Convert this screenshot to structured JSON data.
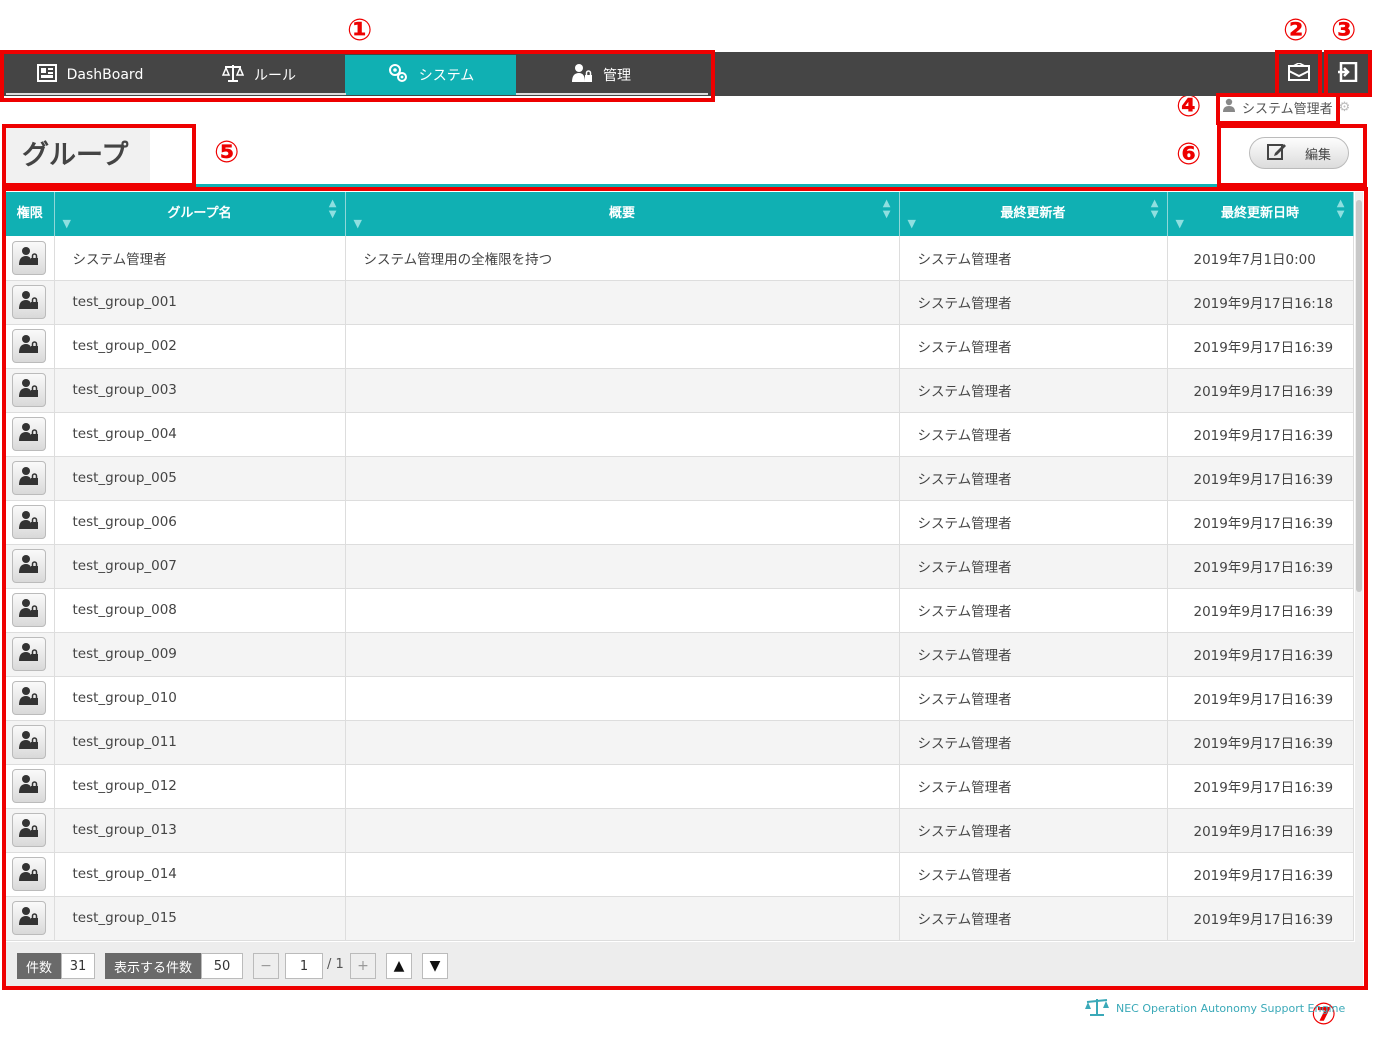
{
  "nav": {
    "items": [
      {
        "label": "DashBoard",
        "icon": "dashboard-icon"
      },
      {
        "label": "ルール",
        "icon": "scale-icon"
      },
      {
        "label": "システム",
        "icon": "gears-icon",
        "active": true
      },
      {
        "label": "管理",
        "icon": "user-lock-icon"
      }
    ]
  },
  "header": {
    "mail_icon": "mail-icon",
    "logout_icon": "logout-icon",
    "user_name": "システム管理者",
    "user_icon": "user-icon",
    "settings_icon": "gear-icon"
  },
  "page": {
    "title": "グループ",
    "edit_label": "編集"
  },
  "table": {
    "columns": [
      "権限",
      "グループ名",
      "概要",
      "最終更新者",
      "最終更新日時"
    ],
    "rows": [
      {
        "name": "システム管理者",
        "summary": "システム管理用の全権限を持つ",
        "updater": "システム管理者",
        "updated": "2019年7月1日0:00"
      },
      {
        "name": "test_group_001",
        "summary": "",
        "updater": "システム管理者",
        "updated": "2019年9月17日16:18"
      },
      {
        "name": "test_group_002",
        "summary": "",
        "updater": "システム管理者",
        "updated": "2019年9月17日16:39"
      },
      {
        "name": "test_group_003",
        "summary": "",
        "updater": "システム管理者",
        "updated": "2019年9月17日16:39"
      },
      {
        "name": "test_group_004",
        "summary": "",
        "updater": "システム管理者",
        "updated": "2019年9月17日16:39"
      },
      {
        "name": "test_group_005",
        "summary": "",
        "updater": "システム管理者",
        "updated": "2019年9月17日16:39"
      },
      {
        "name": "test_group_006",
        "summary": "",
        "updater": "システム管理者",
        "updated": "2019年9月17日16:39"
      },
      {
        "name": "test_group_007",
        "summary": "",
        "updater": "システム管理者",
        "updated": "2019年9月17日16:39"
      },
      {
        "name": "test_group_008",
        "summary": "",
        "updater": "システム管理者",
        "updated": "2019年9月17日16:39"
      },
      {
        "name": "test_group_009",
        "summary": "",
        "updater": "システム管理者",
        "updated": "2019年9月17日16:39"
      },
      {
        "name": "test_group_010",
        "summary": "",
        "updater": "システム管理者",
        "updated": "2019年9月17日16:39"
      },
      {
        "name": "test_group_011",
        "summary": "",
        "updater": "システム管理者",
        "updated": "2019年9月17日16:39"
      },
      {
        "name": "test_group_012",
        "summary": "",
        "updater": "システム管理者",
        "updated": "2019年9月17日16:39"
      },
      {
        "name": "test_group_013",
        "summary": "",
        "updater": "システム管理者",
        "updated": "2019年9月17日16:39"
      },
      {
        "name": "test_group_014",
        "summary": "",
        "updater": "システム管理者",
        "updated": "2019年9月17日16:39"
      },
      {
        "name": "test_group_015",
        "summary": "",
        "updater": "システム管理者",
        "updated": "2019年9月17日16:39"
      }
    ]
  },
  "footer": {
    "count_label": "件数",
    "count_value": "31",
    "per_page_label": "表示する件数",
    "per_page_value": "50",
    "page_current": "1",
    "page_total": "/ 1",
    "prev": "−",
    "next": "+",
    "up": "▲",
    "down": "▼"
  },
  "brand": "NEC Operation Autonomy Support Engine",
  "callouts": [
    "①",
    "②",
    "③",
    "④",
    "⑤",
    "⑥",
    "⑦"
  ],
  "colors": {
    "accent": "#10b0b3",
    "topbar": "#454545",
    "callout": "#ee0000"
  }
}
